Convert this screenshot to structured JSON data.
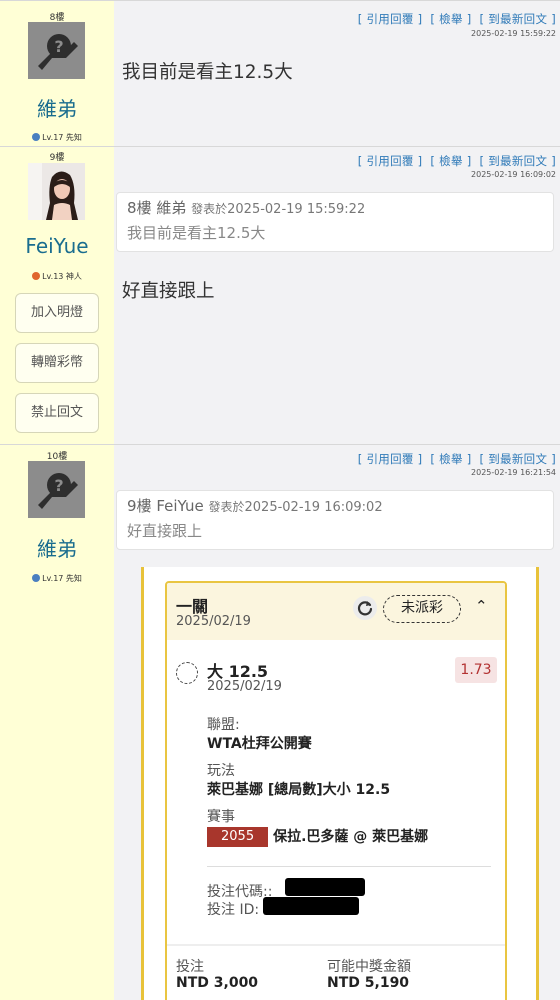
{
  "posts": [
    {
      "floor": "8樓",
      "username": "維弟",
      "level": "Lv.17 先知",
      "actions": [
        "[ 引用回覆 ]",
        "[ 檢舉 ]",
        "[ 到最新回文 ]"
      ],
      "timestamp": "2025-02-19 15:59:22",
      "message": "我目前是看主12.5大"
    },
    {
      "floor": "9樓",
      "username": "FeiYue",
      "level": "Lv.13 神人",
      "side_buttons": [
        "加入明燈",
        "轉贈彩幣",
        "禁止回文"
      ],
      "actions": [
        "[ 引用回覆 ]",
        "[ 檢舉 ]",
        "[ 到最新回文 ]"
      ],
      "timestamp": "2025-02-19 16:09:02",
      "quote": {
        "floor": "8樓",
        "author": "維弟",
        "posted_prefix": "發表於",
        "posted_at": "2025-02-19 15:59:22",
        "text": "我目前是看主12.5大"
      },
      "message": "好直接跟上"
    },
    {
      "floor": "10樓",
      "username": "維弟",
      "level": "Lv.17 先知",
      "actions": [
        "[ 引用回覆 ]",
        "[ 檢舉 ]",
        "[ 到最新回文 ]"
      ],
      "timestamp": "2025-02-19 16:21:54",
      "quote": {
        "floor": "9樓",
        "author": "FeiYue",
        "posted_prefix": "發表於",
        "posted_at": "2025-02-19 16:09:02",
        "text": "好直接跟上"
      }
    }
  ],
  "bet_card": {
    "title": "一關",
    "date": "2025/02/19",
    "status": "未派彩",
    "pick": "大 12.5",
    "pick_date": "2025/02/19",
    "odds": "1.73",
    "league_label": "聯盟:",
    "league": "WTA杜拜公開賽",
    "market_label": "玩法",
    "market": "萊巴基娜 [總局數]大小 12.5",
    "event_label": "賽事",
    "event_id": "2055",
    "event": "保拉.巴多薩 @ 萊巴基娜",
    "code_label": "投注代碼::",
    "id_label": "投注 ID:",
    "stake_label": "投注",
    "stake": "NTD 3,000",
    "payout_label": "可能中獎金額",
    "payout": "NTD 5,190"
  },
  "colors": {
    "user_col_bg": "#ffffd6",
    "link": "#2f7ab8",
    "username": "#1a6d8f",
    "card_border": "#e9c541",
    "odds_text": "#b33232",
    "event_badge": "#a8362c"
  }
}
